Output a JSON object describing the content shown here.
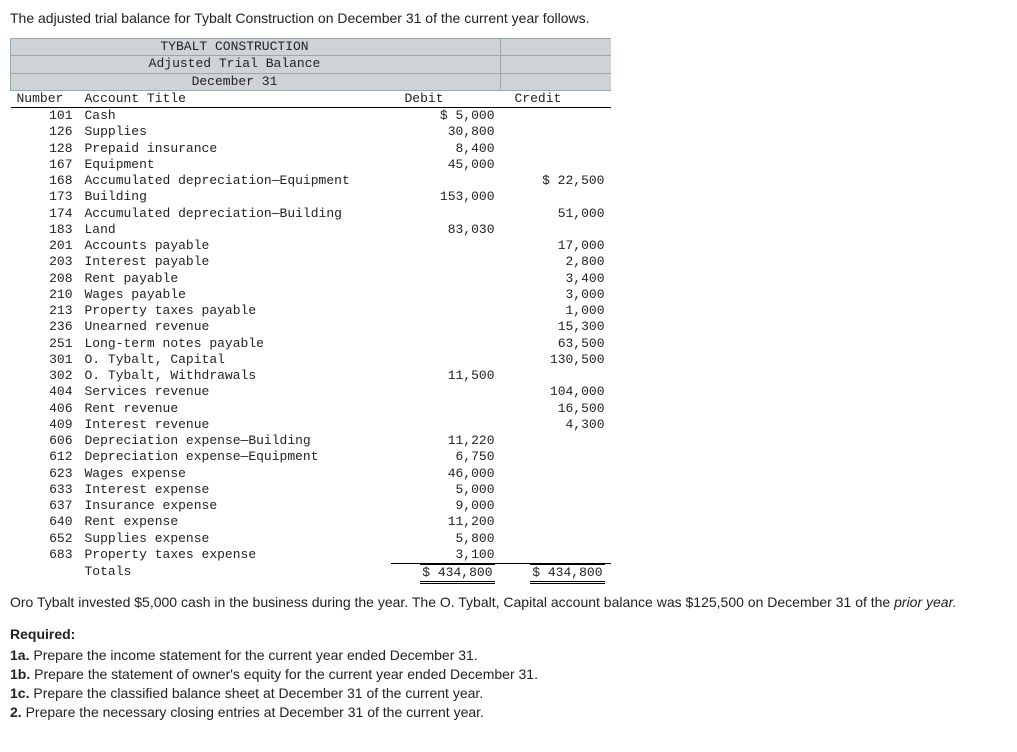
{
  "intro": "The adjusted trial balance for Tybalt Construction on December 31 of the current year follows.",
  "header": {
    "company": "TYBALT CONSTRUCTION",
    "title": "Adjusted Trial Balance",
    "date": "December 31"
  },
  "columns": {
    "number": "Number",
    "account": "Account Title",
    "debit": "Debit",
    "credit": "Credit"
  },
  "rows": [
    {
      "num": "101",
      "title": "Cash",
      "debit": "$ 5,000",
      "credit": ""
    },
    {
      "num": "126",
      "title": "Supplies",
      "debit": "30,800",
      "credit": ""
    },
    {
      "num": "128",
      "title": "Prepaid insurance",
      "debit": "8,400",
      "credit": ""
    },
    {
      "num": "167",
      "title": "Equipment",
      "debit": "45,000",
      "credit": ""
    },
    {
      "num": "168",
      "title": "Accumulated depreciation—Equipment",
      "debit": "",
      "credit": "$ 22,500"
    },
    {
      "num": "173",
      "title": "Building",
      "debit": "153,000",
      "credit": ""
    },
    {
      "num": "174",
      "title": "Accumulated depreciation—Building",
      "debit": "",
      "credit": "51,000"
    },
    {
      "num": "183",
      "title": "Land",
      "debit": "83,030",
      "credit": ""
    },
    {
      "num": "201",
      "title": "Accounts payable",
      "debit": "",
      "credit": "17,000"
    },
    {
      "num": "203",
      "title": "Interest payable",
      "debit": "",
      "credit": "2,800"
    },
    {
      "num": "208",
      "title": "Rent payable",
      "debit": "",
      "credit": "3,400"
    },
    {
      "num": "210",
      "title": "Wages payable",
      "debit": "",
      "credit": "3,000"
    },
    {
      "num": "213",
      "title": "Property taxes payable",
      "debit": "",
      "credit": "1,000"
    },
    {
      "num": "236",
      "title": "Unearned revenue",
      "debit": "",
      "credit": "15,300"
    },
    {
      "num": "251",
      "title": "Long-term notes payable",
      "debit": "",
      "credit": "63,500"
    },
    {
      "num": "301",
      "title": "O. Tybalt, Capital",
      "debit": "",
      "credit": "130,500"
    },
    {
      "num": "302",
      "title": "O. Tybalt, Withdrawals",
      "debit": "11,500",
      "credit": ""
    },
    {
      "num": "404",
      "title": "Services revenue",
      "debit": "",
      "credit": "104,000"
    },
    {
      "num": "406",
      "title": "Rent revenue",
      "debit": "",
      "credit": "16,500"
    },
    {
      "num": "409",
      "title": "Interest revenue",
      "debit": "",
      "credit": "4,300"
    },
    {
      "num": "606",
      "title": "Depreciation expense—Building",
      "debit": "11,220",
      "credit": ""
    },
    {
      "num": "612",
      "title": "Depreciation expense—Equipment",
      "debit": "6,750",
      "credit": ""
    },
    {
      "num": "623",
      "title": "Wages expense",
      "debit": "46,000",
      "credit": ""
    },
    {
      "num": "633",
      "title": "Interest expense",
      "debit": "5,000",
      "credit": ""
    },
    {
      "num": "637",
      "title": "Insurance expense",
      "debit": "9,000",
      "credit": ""
    },
    {
      "num": "640",
      "title": "Rent expense",
      "debit": "11,200",
      "credit": ""
    },
    {
      "num": "652",
      "title": "Supplies expense",
      "debit": "5,800",
      "credit": ""
    },
    {
      "num": "683",
      "title": "Property taxes expense",
      "debit": "3,100",
      "credit": ""
    }
  ],
  "totals": {
    "label": "Totals",
    "debit": "$ 434,800",
    "credit": "$ 434,800"
  },
  "note1a": "Oro Tybalt invested $5,000 cash in the business during the year. The O. Tybalt, Capital account balance was $125,500 on December 31 of the ",
  "note1b": "prior year.",
  "required_label": "Required:",
  "requirements": {
    "r1a_b": "1a.",
    "r1a": " Prepare the income statement for the current year ended December 31.",
    "r1b_b": "1b.",
    "r1b": " Prepare the statement of owner's equity for the current year ended December 31.",
    "r1c_b": "1c.",
    "r1c": " Prepare the classified balance sheet at December 31 of the current year.",
    "r2_b": "2.",
    "r2": " Prepare the necessary closing entries at December 31 of the current year."
  }
}
